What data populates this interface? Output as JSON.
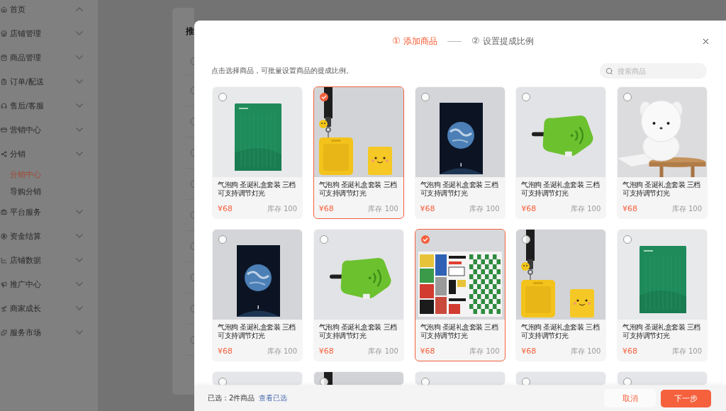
{
  "sidebar": {
    "items": [
      {
        "label": "首页",
        "expanded": true,
        "selected": false
      },
      {
        "label": "店铺管理",
        "expanded": false,
        "selected": false
      },
      {
        "label": "商品管理",
        "expanded": false,
        "selected": false
      },
      {
        "label": "订单/配送",
        "expanded": false,
        "selected": false
      },
      {
        "label": "售后/客服",
        "expanded": false,
        "selected": false
      },
      {
        "label": "营销中心",
        "expanded": false,
        "selected": false
      },
      {
        "label": "分销",
        "expanded": false,
        "selected": false,
        "children": [
          {
            "label": "分销中心",
            "selected": true
          },
          {
            "label": "导购分销",
            "selected": false
          }
        ]
      },
      {
        "label": "平台服务",
        "expanded": false,
        "selected": false
      },
      {
        "label": "资金结算",
        "expanded": false,
        "selected": false
      },
      {
        "label": "店铺数据",
        "expanded": false,
        "selected": false
      },
      {
        "label": "推广中心",
        "expanded": false,
        "selected": false
      },
      {
        "label": "商家成长",
        "expanded": false,
        "selected": false
      },
      {
        "label": "服务市场",
        "expanded": false,
        "selected": false
      }
    ]
  },
  "background_panel": {
    "title": "推",
    "rows": [
      {
        "selected": false
      },
      {
        "selected": false
      },
      {
        "selected": false
      },
      {
        "selected": false
      },
      {
        "selected": false
      },
      {
        "selected": false
      },
      {
        "selected": false
      },
      {
        "selected": false
      },
      {
        "selected": false
      },
      {
        "selected": false
      }
    ]
  },
  "dialog": {
    "steps": [
      {
        "marker": "①",
        "label": "添加商品",
        "selected": true
      },
      {
        "marker": "②",
        "label": "设置提成比例",
        "selected": false
      }
    ],
    "hint": "点击选择商品，可批量设置商品的提成比例。",
    "search": {
      "placeholder": "搜索商品"
    },
    "products": [
      {
        "kind": "notebook",
        "selected": false,
        "title": "气泡狗 圣诞礼盒套装 三档可支持调节灯光",
        "price": "¥68",
        "stock": "库存 100"
      },
      {
        "kind": "badge",
        "selected": true,
        "title": "气泡狗 圣诞礼盒套装 三档可支持调节灯光",
        "price": "¥68",
        "stock": "库存 100"
      },
      {
        "kind": "poster",
        "selected": false,
        "title": "气泡狗 圣诞礼盒套装 三档可支持调节灯光",
        "price": "¥68",
        "stock": "库存 100"
      },
      {
        "kind": "pouch",
        "selected": false,
        "title": "气泡狗 圣诞礼盒套装 三档可支持调节灯光",
        "price": "¥68",
        "stock": "库存 100"
      },
      {
        "kind": "plush",
        "selected": false,
        "title": "气泡狗 圣诞礼盒套装 三档可支持调节灯光",
        "price": "¥68",
        "stock": "库存 100"
      },
      {
        "kind": "poster",
        "selected": false,
        "title": "气泡狗 圣诞礼盒套装 三档可支持调节灯光",
        "price": "¥68",
        "stock": "库存 100"
      },
      {
        "kind": "pouch",
        "selected": false,
        "title": "气泡狗 圣诞礼盒套装 三档可支持调节灯光",
        "price": "¥68",
        "stock": "库存 100"
      },
      {
        "kind": "chart",
        "selected": true,
        "title": "气泡狗 圣诞礼盒套装 三档可支持调节灯光",
        "price": "¥68",
        "stock": "库存 100"
      },
      {
        "kind": "badge",
        "selected": false,
        "title": "气泡狗 圣诞礼盒套装 三档可支持调节灯光",
        "price": "¥68",
        "stock": "库存 100"
      },
      {
        "kind": "notebook",
        "selected": false,
        "title": "气泡狗 圣诞礼盒套装 三档可支持调节灯光",
        "price": "¥68",
        "stock": "库存 100"
      },
      {
        "kind": "blank",
        "selected": false
      },
      {
        "kind": "badge",
        "selected": false
      },
      {
        "kind": "blank",
        "selected": false
      },
      {
        "kind": "blank",
        "selected": false
      },
      {
        "kind": "blank",
        "selected": false
      }
    ],
    "footer": {
      "summary": "已选：2件商品",
      "link": "查看已选",
      "buttons": [
        {
          "label": "取消",
          "kind": "secondary"
        },
        {
          "label": "下一步",
          "kind": "primary"
        }
      ]
    }
  }
}
